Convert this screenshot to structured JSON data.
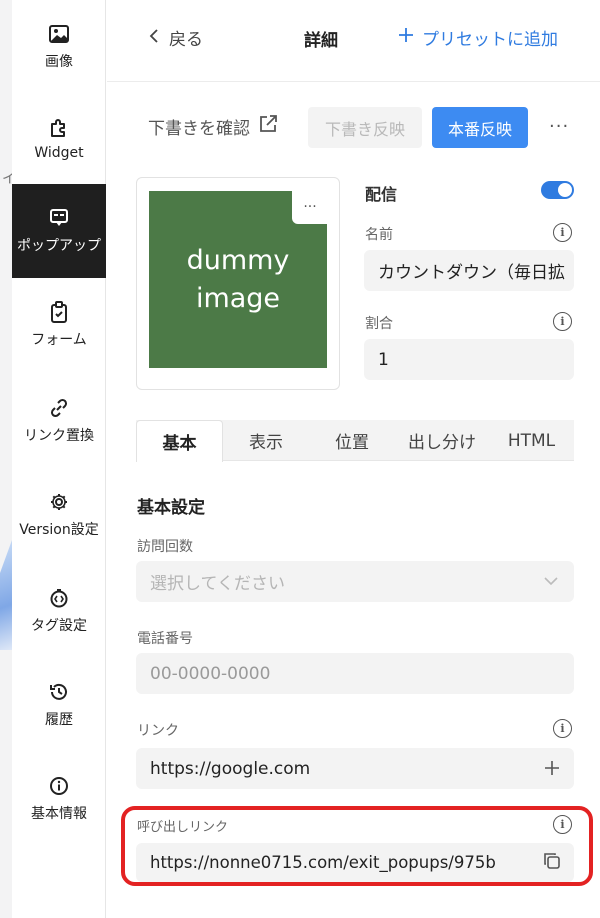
{
  "sidebar": {
    "items": [
      {
        "label": "画像",
        "icon": "image-icon"
      },
      {
        "label": "Widget",
        "icon": "puzzle-icon"
      },
      {
        "label": "ポップアップ",
        "icon": "popup-icon",
        "active": true
      },
      {
        "label": "フォーム",
        "icon": "clipboard-icon"
      },
      {
        "label": "リンク置換",
        "icon": "link-icon"
      },
      {
        "label": "Version設定",
        "icon": "gear-icon"
      },
      {
        "label": "タグ設定",
        "icon": "tag-code-icon"
      },
      {
        "label": "履歴",
        "icon": "history-icon"
      },
      {
        "label": "基本情報",
        "icon": "info-icon"
      }
    ]
  },
  "header": {
    "back_label": "戻る",
    "title": "詳細",
    "add_preset_label": "プリセットに追加"
  },
  "toolbar": {
    "check_draft_label": "下書きを確認",
    "draft_apply_label": "下書き反映",
    "prod_apply_label": "本番反映",
    "more_label": "···"
  },
  "image_card": {
    "placeholder_text_line1": "dummy",
    "placeholder_text_line2": "image",
    "more_label": "···"
  },
  "delivery": {
    "label": "配信",
    "enabled": true
  },
  "fields": {
    "name_label": "名前",
    "name_value": "カウントダウン（毎日拡",
    "ratio_label": "割合",
    "ratio_value": "1"
  },
  "tabs": [
    "基本",
    "表示",
    "位置",
    "出し分け",
    "HTML"
  ],
  "basic": {
    "section_title": "基本設定",
    "visits_label": "訪問回数",
    "visits_placeholder": "選択してください",
    "phone_label": "電話番号",
    "phone_placeholder": "00-0000-0000",
    "link_label": "リンク",
    "link_value": "https://google.com",
    "callout_label": "呼び出しリンク",
    "callout_value": "https://nonne0715.com/exit_popups/975b"
  },
  "colors": {
    "accent": "#3d8bf2",
    "highlight": "#e32222",
    "image_bg": "#4c7a47",
    "active_nav": "#1f1f1f"
  }
}
